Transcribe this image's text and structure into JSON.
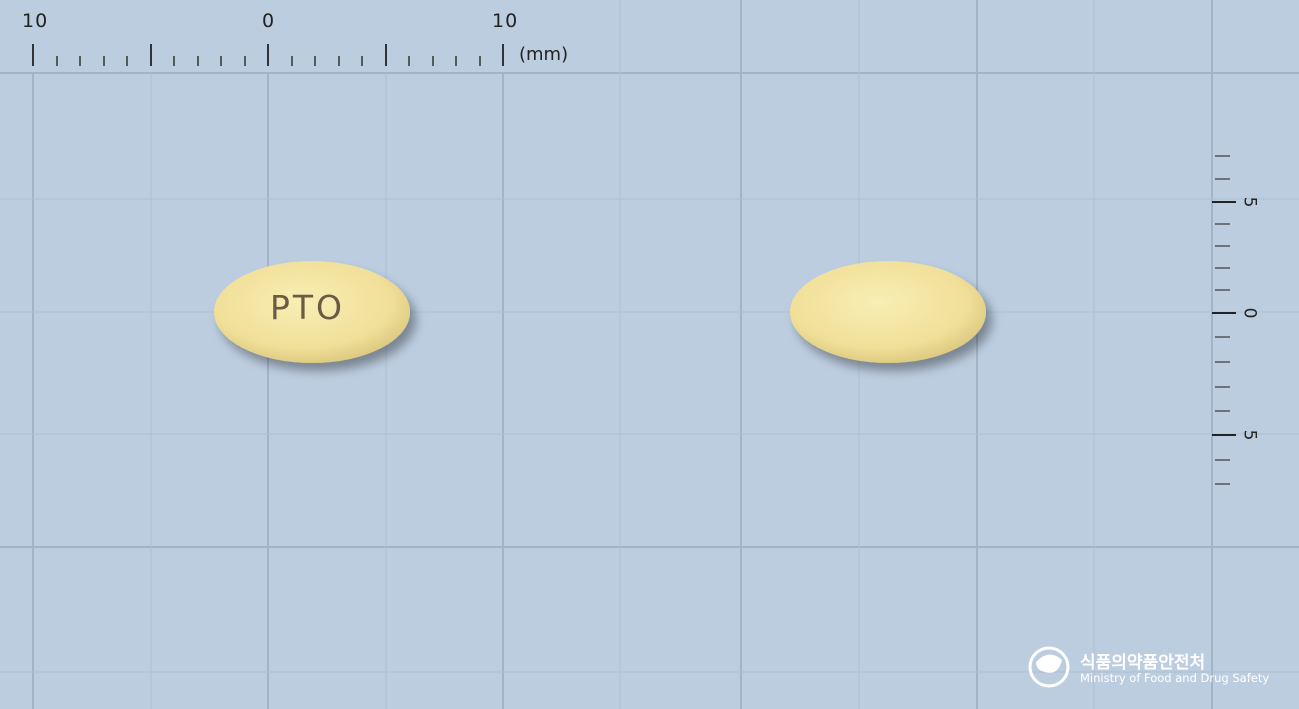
{
  "ruler": {
    "horizontal_labels": [
      "10",
      "0",
      "10"
    ],
    "unit": "(mm)",
    "vertical_labels": [
      "5",
      "0",
      "5"
    ]
  },
  "pills": {
    "front_imprint": "PTO",
    "color": "#f1e29a"
  },
  "logo": {
    "korean": "식품의약품안전처",
    "english": "Ministry of Food and Drug Safety"
  },
  "colors": {
    "background": "#bccde0",
    "grid": "#a3b4c6"
  }
}
